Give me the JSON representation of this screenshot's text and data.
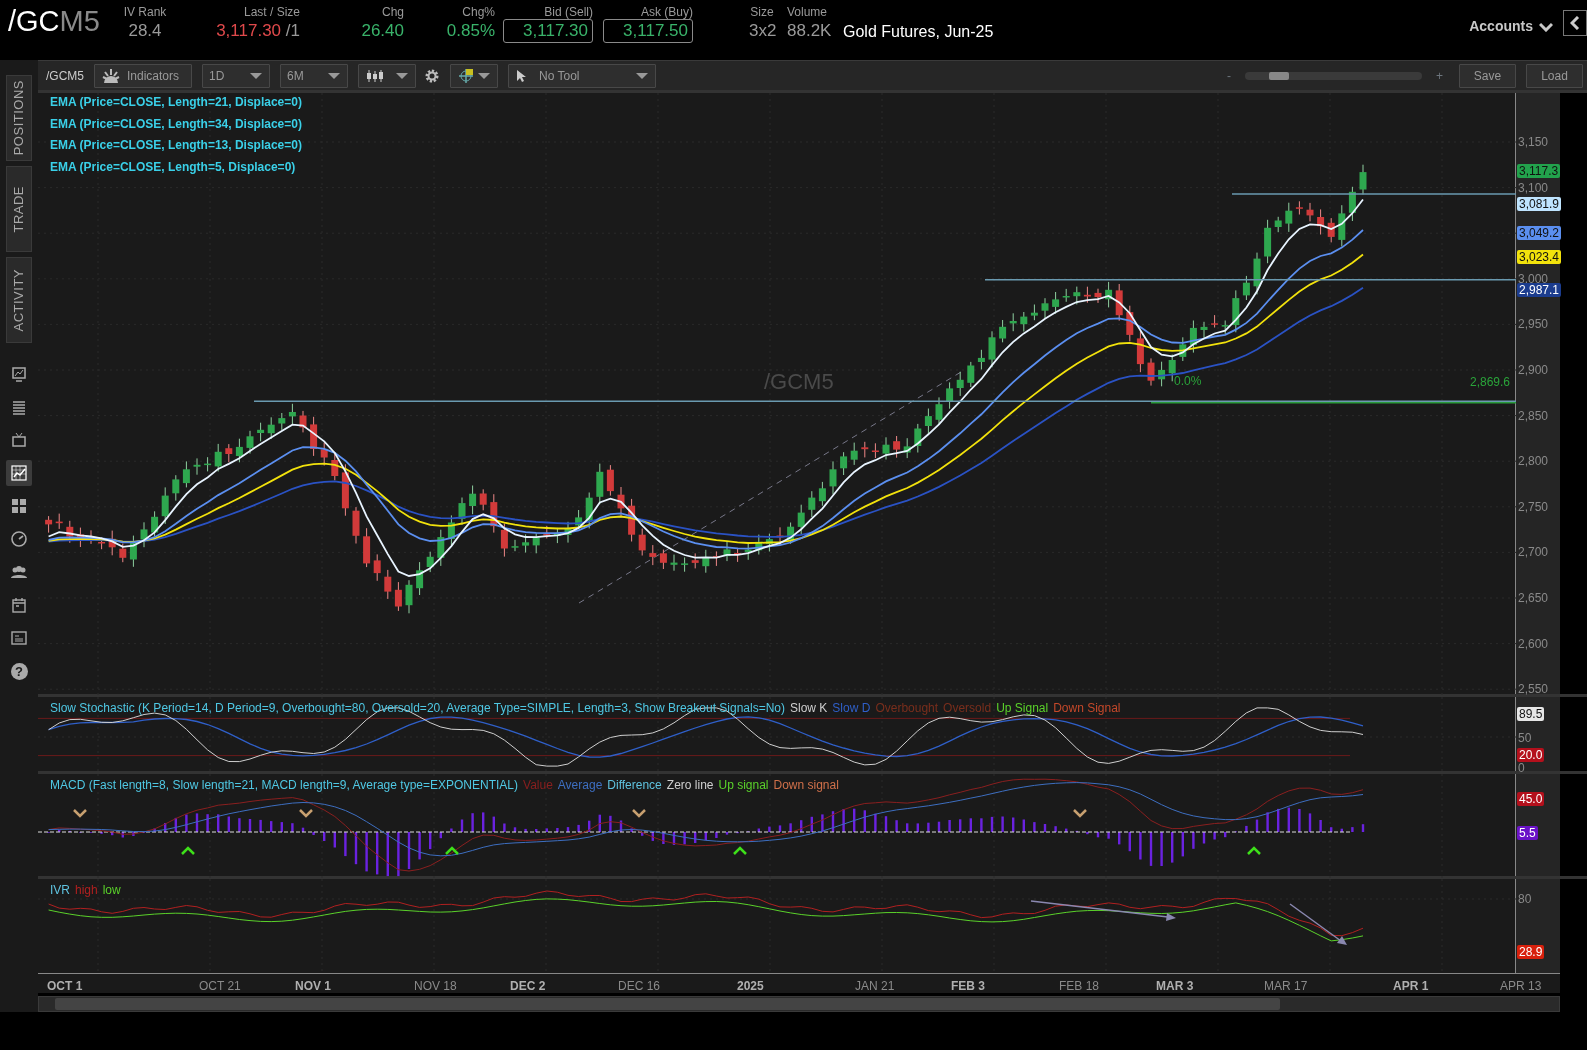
{
  "header": {
    "symbol_root": "/GC",
    "symbol_month": "M5",
    "stats": [
      {
        "label": "IV Rank",
        "value": "28.4",
        "kind": "plain"
      },
      {
        "label": "Last / Size",
        "value": "3,117.30",
        "extra": "/1",
        "kind": "last"
      },
      {
        "label": "Chg",
        "value": "26.40",
        "kind": "up"
      },
      {
        "label": "Chg%",
        "value": "0.85%",
        "kind": "up"
      },
      {
        "label": "Bid (Sell)",
        "value": "3,117.30",
        "kind": "quote"
      },
      {
        "label": "Ask (Buy)",
        "value": "3,117.50",
        "kind": "quote"
      },
      {
        "label": "Size",
        "value": "3x2",
        "kind": "plain"
      },
      {
        "label": "Volume",
        "value": "88.2K",
        "kind": "plain"
      }
    ],
    "description": "Gold Futures, Jun-25",
    "accounts": "Accounts"
  },
  "sidebar": {
    "tabs": [
      {
        "label": "POSITIONS",
        "selected": false
      },
      {
        "label": "TRADE",
        "selected": false
      },
      {
        "label": "ACTIVITY",
        "selected": false
      }
    ],
    "icons": [
      {
        "kind": "monitor",
        "selected": false
      },
      {
        "kind": "list",
        "selected": false
      },
      {
        "kind": "tv",
        "selected": false
      },
      {
        "kind": "chart",
        "selected": true
      },
      {
        "kind": "grid",
        "selected": false
      },
      {
        "kind": "gauge",
        "selected": false
      },
      {
        "kind": "people",
        "selected": false
      },
      {
        "kind": "calendar",
        "selected": false
      },
      {
        "kind": "news",
        "selected": false
      },
      {
        "kind": "help",
        "glyph": "?",
        "selected": false
      }
    ]
  },
  "toolbar": {
    "symbol": "/GCM5",
    "indicators": "Indicators",
    "interval": "1D",
    "range": "6M",
    "tool": "No Tool",
    "zoom_out": "-",
    "zoom_in": "+",
    "zoom": {
      "level": 0.15
    },
    "save": "Save",
    "load": "Load"
  },
  "price_panel": {
    "legends": [
      {
        "text": "EMA (Price=CLOSE, Length=21, Displace=0)"
      },
      {
        "text": "EMA (Price=CLOSE, Length=34, Displace=0)"
      },
      {
        "text": "EMA (Price=CLOSE, Length=13, Displace=0)"
      },
      {
        "text": "EMA (Price=CLOSE, Length=5, Displace=0)"
      }
    ],
    "symbol_label": "/GCM5",
    "fib_label": "0.0%",
    "fib_value": "2,869.6",
    "axis_ticks": [
      "3,150",
      "3,100",
      "3,000",
      "2,950",
      "2,900",
      "2,850",
      "2,800",
      "2,750",
      "2,700",
      "2,650",
      "2,600",
      "2,550"
    ],
    "badges": [
      {
        "text": "3,117.3",
        "color": "#22a24c"
      },
      {
        "text": "3,081.9",
        "color": "#bfe4ff"
      },
      {
        "text": "3,049.2",
        "color": "#5b8ff0"
      },
      {
        "text": "3,023.4",
        "color": "#f2e20c"
      },
      {
        "text": "2,987.1",
        "color": "#1b3c8e"
      }
    ]
  },
  "stochastic_panel": {
    "legend": [
      {
        "text": "Slow Stochastic (K Period=14, D Period=9, Overbought=80, Oversold=20, Average Type=SIMPLE, Length=3, Show Breakout Signals=No)",
        "color": "#4fc8e4"
      },
      {
        "text": "Slow K",
        "color": "#cfcfcf"
      },
      {
        "text": "Slow D",
        "color": "#2f5fc8"
      },
      {
        "text": "Overbought",
        "color": "#7a2e1c"
      },
      {
        "text": "Oversold",
        "color": "#7a2e1c"
      },
      {
        "text": "Up Signal",
        "color": "#5ad12a"
      },
      {
        "text": "Down Signal",
        "color": "#c4482a"
      }
    ],
    "axis": [
      {
        "text": "89.5",
        "kind": "badge",
        "color": "#e6e6e6"
      },
      {
        "text": "50",
        "kind": "tick"
      },
      {
        "text": "20.0",
        "kind": "badge",
        "color": "#b4101c"
      },
      {
        "text": "0",
        "kind": "tick"
      }
    ]
  },
  "macd_panel": {
    "legend": [
      {
        "text": "MACD (Fast length=8, Slow length=21, MACD length=9, Average type=EXPONENTIAL)",
        "color": "#4fc8e4"
      },
      {
        "text": "Value",
        "color": "#8a1f1f"
      },
      {
        "text": "Average",
        "color": "#3d6ec0"
      },
      {
        "text": "Difference",
        "color": "#5fc3e0"
      },
      {
        "text": "Zero line",
        "color": "#cfcfcf"
      },
      {
        "text": "Up signal",
        "color": "#5ad12a"
      },
      {
        "text": "Down signal",
        "color": "#d0704a"
      }
    ],
    "axis": [
      {
        "text": "45.0",
        "kind": "badge",
        "color": "#b4101c"
      },
      {
        "text": "5.5",
        "kind": "badge",
        "color": "#6a12c8"
      }
    ]
  },
  "ivr_panel": {
    "legend": [
      {
        "text": "IVR",
        "color": "#5fc3e0"
      },
      {
        "text": "high",
        "color": "#b02020"
      },
      {
        "text": "low",
        "color": "#5ad12a"
      }
    ],
    "axis": [
      {
        "text": "80",
        "kind": "tick"
      },
      {
        "text": "28.9",
        "kind": "badge",
        "color": "#d8200c"
      }
    ]
  },
  "date_axis": [
    {
      "text": "OCT 1",
      "major": true
    },
    {
      "text": "OCT 21",
      "major": false
    },
    {
      "text": "NOV 1",
      "major": true
    },
    {
      "text": "NOV 18",
      "major": false
    },
    {
      "text": "DEC 2",
      "major": true
    },
    {
      "text": "DEC 16",
      "major": false
    },
    {
      "text": "2025",
      "major": true
    },
    {
      "text": "JAN 21",
      "major": false
    },
    {
      "text": "FEB 3",
      "major": true
    },
    {
      "text": "FEB 18",
      "major": false
    },
    {
      "text": "MAR 3",
      "major": true
    },
    {
      "text": "MAR 17",
      "major": false
    },
    {
      "text": "APR 1",
      "major": true
    },
    {
      "text": "APR 13",
      "major": false
    }
  ]
}
